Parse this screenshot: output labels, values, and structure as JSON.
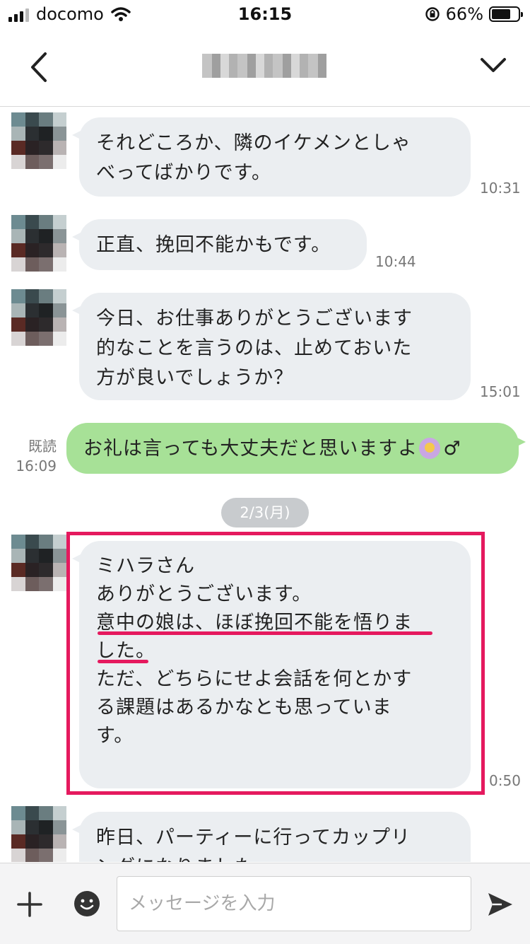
{
  "status_bar": {
    "carrier": "docomo",
    "time": "16:15",
    "battery": "66%",
    "battery_level": 0.66
  },
  "header": {
    "back_icon": "chevron-left-icon",
    "menu_icon": "chevron-down-icon"
  },
  "messages": [
    {
      "sender": "other",
      "text": "それどころか、隣のイケメンとしゃ\nべってばかりです。",
      "time": "10:31"
    },
    {
      "sender": "other",
      "text": "正直、挽回不能かもです。",
      "time": "10:44"
    },
    {
      "sender": "other",
      "text": "今日、お仕事ありがとうございます\n的なことを言うのは、止めておいた\n方が良いでしょうか？",
      "time": "15:01"
    },
    {
      "sender": "me",
      "text": "お礼は言っても大丈夫だと思いますよ",
      "text_after_emoji": "♂",
      "read": "既読",
      "time": "16:09"
    }
  ],
  "date_separator": "2/3(月)",
  "highlighted_message": {
    "lines": [
      "ミハラさん",
      "ありがとうございます。",
      "意中の娘は、ほぼ挽回不能を悟りま",
      "した。",
      "ただ、どちらにせよ会話を何とかす",
      "る課題はあるかなとも思っていま",
      "す。"
    ],
    "time": "0:50"
  },
  "last_message": {
    "text": "昨日、パーティーに行ってカップリ\nングになりました。"
  },
  "input_bar": {
    "placeholder": "メッセージを入力",
    "value": ""
  },
  "colors": {
    "accent_red": "#e5195e",
    "my_bubble": "#a7e197",
    "their_bubble": "#ebeef1"
  }
}
